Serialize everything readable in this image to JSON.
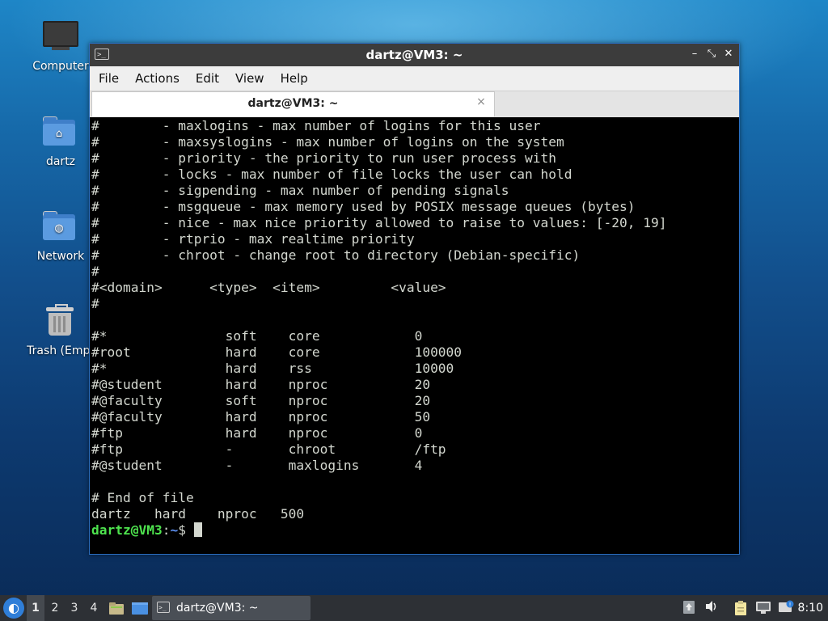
{
  "desktop": {
    "icons": [
      {
        "label": "Computer",
        "icon": "computer-icon"
      },
      {
        "label": "dartz",
        "icon": "home-folder-icon"
      },
      {
        "label": "Network",
        "icon": "network-folder-icon"
      },
      {
        "label": "Trash (Empt",
        "icon": "trash-icon"
      }
    ]
  },
  "window": {
    "title": "dartz@VM3: ~",
    "menu": [
      "File",
      "Actions",
      "Edit",
      "View",
      "Help"
    ],
    "tab_label": "dartz@VM3: ~",
    "tab_close": "×",
    "controls": {
      "minimize": "–",
      "maximize": "⤡",
      "close": "✕"
    }
  },
  "terminal": {
    "lines": [
      "#        - maxlogins - max number of logins for this user",
      "#        - maxsyslogins - max number of logins on the system",
      "#        - priority - the priority to run user process with",
      "#        - locks - max number of file locks the user can hold",
      "#        - sigpending - max number of pending signals",
      "#        - msgqueue - max memory used by POSIX message queues (bytes)",
      "#        - nice - max nice priority allowed to raise to values: [-20, 19]",
      "#        - rtprio - max realtime priority",
      "#        - chroot - change root to directory (Debian-specific)",
      "#",
      "#<domain>      <type>  <item>         <value>",
      "#",
      "",
      "#*               soft    core            0",
      "#root            hard    core            100000",
      "#*               hard    rss             10000",
      "#@student        hard    nproc           20",
      "#@faculty        soft    nproc           20",
      "#@faculty        hard    nproc           50",
      "#ftp             hard    nproc           0",
      "#ftp             -       chroot          /ftp",
      "#@student        -       maxlogins       4",
      "",
      "# End of file",
      "dartz   hard    nproc   500"
    ],
    "prompt_user": "dartz@VM3",
    "prompt_sep": ":",
    "prompt_path": "~",
    "prompt_symbol": "$ "
  },
  "taskbar": {
    "workspaces": [
      "1",
      "2",
      "3",
      "4"
    ],
    "active_workspace": "1",
    "task_label": "dartz@VM3: ~",
    "clock": "8:10"
  }
}
